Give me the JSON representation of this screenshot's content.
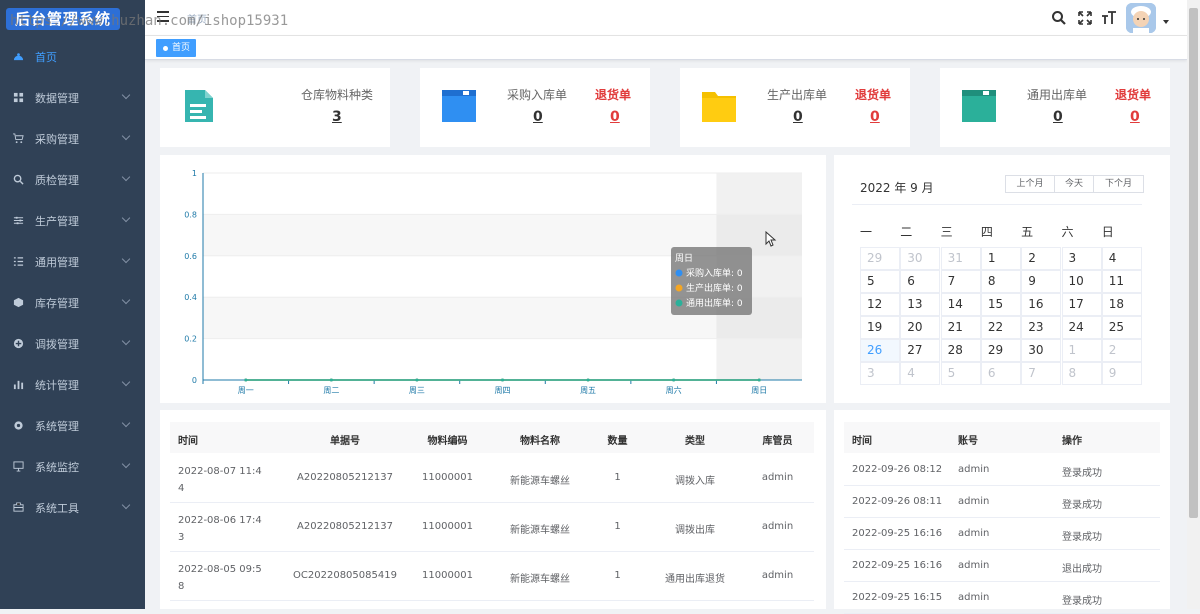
{
  "app_title": "后台管理系统",
  "watermark": "https://www.huzhan.com/ishop15931",
  "breadcrumb": "首页",
  "tag": "首页",
  "sidebar": {
    "items": [
      {
        "label": "首页",
        "icon": "dashboard-icon"
      },
      {
        "label": "数据管理",
        "icon": "grid-icon"
      },
      {
        "label": "采购管理",
        "icon": "cart-icon"
      },
      {
        "label": "质检管理",
        "icon": "search-icon"
      },
      {
        "label": "生产管理",
        "icon": "sliders-icon"
      },
      {
        "label": "通用管理",
        "icon": "list-icon"
      },
      {
        "label": "库存管理",
        "icon": "cube-icon"
      },
      {
        "label": "调拨管理",
        "icon": "exchange-icon"
      },
      {
        "label": "统计管理",
        "icon": "bar-chart-icon"
      },
      {
        "label": "系统管理",
        "icon": "gear-icon"
      },
      {
        "label": "系统监控",
        "icon": "monitor-icon"
      },
      {
        "label": "系统工具",
        "icon": "toolbox-icon"
      }
    ]
  },
  "stats": [
    {
      "title": "仓库物料种类",
      "value": "3",
      "color": "#36b5b0"
    },
    {
      "title": "采购入库单",
      "value": "0",
      "return_title": "退货单",
      "return_value": "0",
      "color": "#2f8ff2"
    },
    {
      "title": "生产出库单",
      "value": "0",
      "return_title": "退货单",
      "return_value": "0",
      "color": "#f5c000"
    },
    {
      "title": "通用出库单",
      "value": "0",
      "return_title": "退货单",
      "return_value": "0",
      "color": "#2bb09a"
    }
  ],
  "chart_data": {
    "type": "line",
    "categories": [
      "周一",
      "周二",
      "周三",
      "周四",
      "周五",
      "周六",
      "周日"
    ],
    "yticks": [
      "0",
      "0.2",
      "0.4",
      "0.6",
      "0.8",
      "1"
    ],
    "ylim": [
      0,
      1
    ],
    "series": [
      {
        "name": "采购入库单",
        "color": "#2f8ff2",
        "values": [
          0,
          0,
          0,
          0,
          0,
          0,
          0
        ]
      },
      {
        "name": "生产出库单",
        "color": "#f5a623",
        "values": [
          0,
          0,
          0,
          0,
          0,
          0,
          0
        ]
      },
      {
        "name": "通用出库单",
        "color": "#2bb09a",
        "values": [
          0,
          0,
          0,
          0,
          0,
          0,
          0
        ]
      }
    ],
    "tooltip": {
      "title": "周日",
      "rows": [
        "采购入库单: 0",
        "生产出库单: 0",
        "通用出库单: 0"
      ]
    }
  },
  "calendar": {
    "title": "2022 年 9 月",
    "buttons": [
      "上个月",
      "今天",
      "下个月"
    ],
    "weekdays": [
      "一",
      "二",
      "三",
      "四",
      "五",
      "六",
      "日"
    ],
    "weeks": [
      [
        "29",
        "30",
        "31",
        "1",
        "2",
        "3",
        "4"
      ],
      [
        "5",
        "6",
        "7",
        "8",
        "9",
        "10",
        "11"
      ],
      [
        "12",
        "13",
        "14",
        "15",
        "16",
        "17",
        "18"
      ],
      [
        "19",
        "20",
        "21",
        "22",
        "23",
        "24",
        "25"
      ],
      [
        "26",
        "27",
        "28",
        "29",
        "30",
        "1",
        "2"
      ],
      [
        "3",
        "4",
        "5",
        "6",
        "7",
        "8",
        "9"
      ]
    ],
    "today": "26"
  },
  "records_table": {
    "headers": [
      "时间",
      "单据号",
      "物料编码",
      "物料名称",
      "数量",
      "类型",
      "库管员"
    ],
    "rows": [
      {
        "time1": "2022-08-07 11:4",
        "time2": "4",
        "doc": "A20220805212137",
        "code": "11000001",
        "name": "新能源车螺丝",
        "qty": "1",
        "type": "调拨入库",
        "keeper": "admin"
      },
      {
        "time1": "2022-08-06 17:4",
        "time2": "3",
        "doc": "A20220805212137",
        "code": "11000001",
        "name": "新能源车螺丝",
        "qty": "1",
        "type": "调拨出库",
        "keeper": "admin"
      },
      {
        "time1": "2022-08-05 09:5",
        "time2": "8",
        "doc": "OC20220805085419",
        "code": "11000001",
        "name": "新能源车螺丝",
        "qty": "1",
        "type": "通用出库退货",
        "keeper": "admin"
      }
    ]
  },
  "login_table": {
    "headers": [
      "时间",
      "账号",
      "操作"
    ],
    "rows": [
      {
        "time": "2022-09-26 08:12",
        "account": "admin",
        "op": "登录成功"
      },
      {
        "time": "2022-09-26 08:11",
        "account": "admin",
        "op": "登录成功"
      },
      {
        "time": "2022-09-25 16:16",
        "account": "admin",
        "op": "登录成功"
      },
      {
        "time": "2022-09-25 16:16",
        "account": "admin",
        "op": "退出成功"
      },
      {
        "time": "2022-09-25 16:15",
        "account": "admin",
        "op": "登录成功"
      }
    ]
  }
}
